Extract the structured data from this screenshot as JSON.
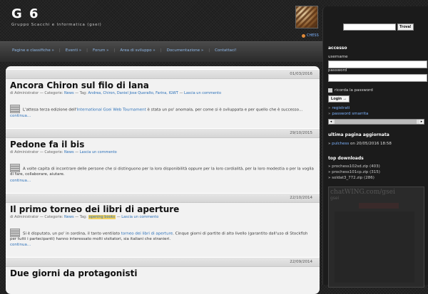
{
  "header": {
    "title": "G 6",
    "description": "Gruppo Scacchi e Informatica (gsei)",
    "chess_link": "CHESS"
  },
  "nav": {
    "items": [
      "Pagine e classifiche »",
      "Eventi »",
      "Forum »",
      "Area di sviluppo »",
      "Documentazione »",
      "Contattaci!"
    ],
    "separator": "|"
  },
  "posts": [
    {
      "date": "01/03/2016",
      "title": "Ancora Chiron sul filo di lana",
      "meta_prefix": "di Administrator — Categorie:",
      "category": "News",
      "tags_label": "— Tag:",
      "tags": "Andrea, Chiron, Daniel Jose Queralto, Farina, IGWT",
      "comment": "Lascia un commento",
      "body_pre": "L'attesa terza edizione dell'",
      "body_link": "International Gsei Web Tournament",
      "body_post": " è stata un po' anomala, per come si è sviluppata e per quello che è successo…",
      "continue": "continua..."
    },
    {
      "date": "29/10/2015",
      "title": "Pedone fa il bis",
      "meta_prefix": "di Administrator — Categorie:",
      "category": "News",
      "comment": "Lascia un commento",
      "body": "A volte capita di incontrare delle persone che si distinguono per la loro disponibilità oppure per la loro cordialità, per la loro modestia o per la voglia di fare, collaborare, aiutare.",
      "continue": "continua..."
    },
    {
      "date": "22/10/2014",
      "title": "Il primo torneo dei libri di aperture",
      "meta_prefix": "di Administrator — Categorie:",
      "category": "News",
      "tags_label": "— Tag:",
      "tags": "opening books",
      "comment": "Lascia un commento",
      "body_pre": "Si è disputato, un po' in sordina, il tanto ventilato ",
      "body_link": "torneo dei libri di aperture",
      "body_post": ". Cinque giorni di partite di alto livello (garantito dall'uso di Stockfish per tutti i partecipanti) hanno interessato molti visitatori, sia italiani che stranieri.",
      "continue": "continua..."
    },
    {
      "date": "22/09/2014",
      "title": "Due giorni da protagonisti"
    }
  ],
  "sidebar": {
    "search_button": "Trova!",
    "access_title": "accesso",
    "username_label": "username",
    "password_label": "password",
    "remember_label": "ricorda la password",
    "login_button": "Login →",
    "register_link": "registrati",
    "lost_password_link": "password smarrita",
    "last_update_title": "ultima pagina aggiornata",
    "last_update_link": "pulchess",
    "last_update_text": " on 20/05/2016 18:58",
    "downloads_title": "top downloads",
    "downloads": [
      "prochess102sd.zip (403)",
      "prochess101cp.zip (315)",
      "soldat3_772.zip (286)"
    ],
    "chat_logo": "chatWING.com/gsei",
    "chat_sub": "gsei"
  }
}
